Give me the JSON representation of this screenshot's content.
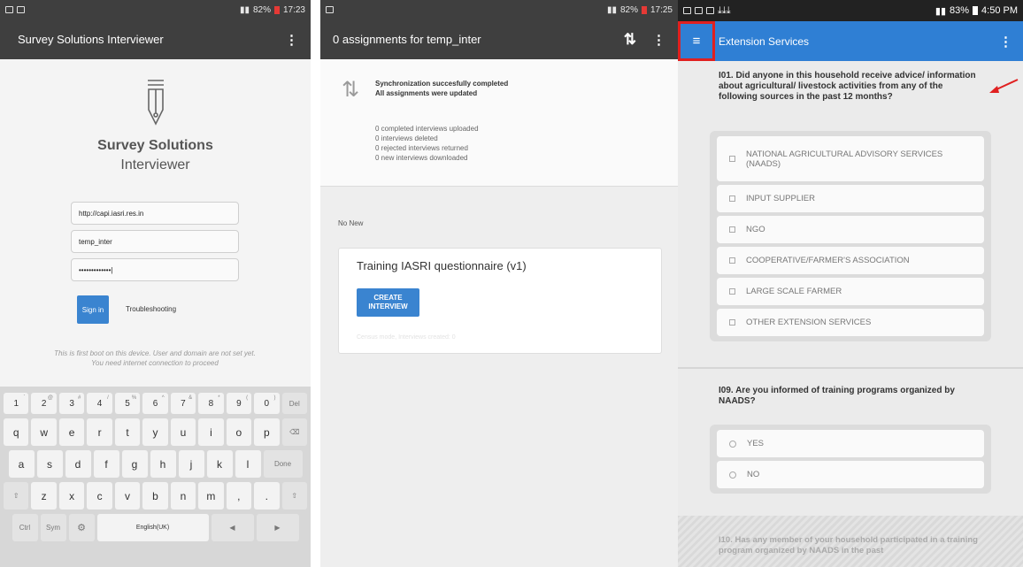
{
  "screen1": {
    "status": {
      "time": "17:23",
      "battery": "82%"
    },
    "appbar": {
      "title": "Survey Solutions Interviewer",
      "menu": "⋮"
    },
    "brand": {
      "line1": "Survey Solutions",
      "line2": "Interviewer"
    },
    "fields": {
      "url": "http://capi.iasri.res.in",
      "user": "temp_inter",
      "password": "•••••••••••••|"
    },
    "signin_label": "Sign in",
    "troubleshooting_label": "Troubleshooting",
    "notice": {
      "line1": "This is first boot on this device. User and domain are not set yet.",
      "line2": "You need internet connection to proceed"
    },
    "keyboard": {
      "num_row": [
        {
          "main": "1",
          "sup": "`"
        },
        {
          "main": "2",
          "sup": "@"
        },
        {
          "main": "3",
          "sup": "#"
        },
        {
          "main": "4",
          "sup": "/"
        },
        {
          "main": "5",
          "sup": "%"
        },
        {
          "main": "6",
          "sup": "^"
        },
        {
          "main": "7",
          "sup": "&"
        },
        {
          "main": "8",
          "sup": "*"
        },
        {
          "main": "9",
          "sup": "("
        },
        {
          "main": "0",
          "sup": ")"
        },
        {
          "main": "Del",
          "sup": ""
        }
      ],
      "row1": [
        "q",
        "w",
        "e",
        "r",
        "t",
        "y",
        "u",
        "i",
        "o",
        "p",
        "⌫"
      ],
      "row2": [
        "a",
        "s",
        "d",
        "f",
        "g",
        "h",
        "j",
        "k",
        "l",
        "Done"
      ],
      "row3": [
        "⇧",
        "z",
        "x",
        "c",
        "v",
        "b",
        "n",
        "m",
        ",",
        ".",
        "⇧"
      ],
      "row4": {
        "ctrl": "Ctrl",
        "sym": "Sym",
        "settings": "⚙",
        "space": "English(UK)",
        "left": "◀",
        "right": "▶"
      }
    }
  },
  "screen2": {
    "status": {
      "time": "17:25",
      "battery": "82%"
    },
    "appbar": {
      "title": "0 assignments for temp_inter",
      "sync_icon": "⇅",
      "menu": "⋮"
    },
    "sync": {
      "title1": "Synchronization succesfully completed",
      "title2": "All assignments were updated",
      "stats": [
        "0 completed interviews uploaded",
        "0 interviews deleted",
        "0 rejected interviews returned",
        "0 new interviews downloaded"
      ]
    },
    "no_new": "No New",
    "card": {
      "title": "Training IASRI questionnaire (v1)",
      "button_line1": "CREATE",
      "button_line2": "INTERVIEW",
      "footer": "Census mode, Interviews created: 0"
    }
  },
  "screen3": {
    "status": {
      "time": "4:50 PM",
      "battery": "83%"
    },
    "appbar": {
      "title": "Extension Services",
      "menu": "⋮",
      "hamburger": "≡"
    },
    "q1": {
      "text": "I01. Did anyone in this household receive advice/ information about agricultural/ livestock activities from any of the following sources in the past 12 months?",
      "options": [
        "NATIONAL AGRICULTURAL ADVISORY SERVICES (NAADS)",
        "INPUT SUPPLIER",
        "NGO",
        "COOPERATIVE/FARMER'S ASSOCIATION",
        "LARGE SCALE FARMER",
        "OTHER EXTENSION SERVICES"
      ]
    },
    "q2": {
      "text": "I09. Are you informed of training programs organized by NAADS?",
      "options": [
        "YES",
        "NO"
      ]
    },
    "q3": {
      "text": "I10. Has any member of your household participated in a training program organized by NAADS in the past"
    },
    "colors": {
      "accent": "#2f7fd4",
      "highlight": "#e02020"
    }
  }
}
